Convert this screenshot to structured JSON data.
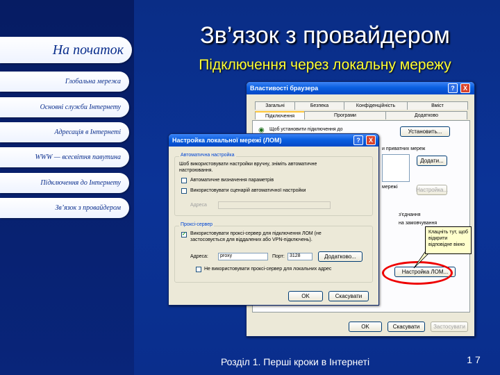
{
  "slide": {
    "title": "Зв’язок з провайдером",
    "subtitle": "Підключення через локальну мережу",
    "footer": "Розділ 1. Перші кроки в Інтернеті",
    "page_number": "1 7"
  },
  "nav": {
    "items": [
      {
        "label": "На початок"
      },
      {
        "label": "Глобальна мережа"
      },
      {
        "label": "Основні служби Інтернету"
      },
      {
        "label": "Адресація в Інтернеті"
      },
      {
        "label": "WWW — всесвітня павутина"
      },
      {
        "label": "Підключення до Інтернету"
      },
      {
        "label": "Зв’язок з провайдером"
      }
    ]
  },
  "browser_props": {
    "title": "Властивості браузера",
    "help": "?",
    "close": "X",
    "tabs": [
      "Загальні",
      "Безпека",
      "Конфіденційність",
      "Вміст",
      "Підключення",
      "Програми",
      "Додатково"
    ],
    "setup_text": "Щоб установити підключення до",
    "setup_button": "Установить...",
    "dialup_text": "и приватних мереж",
    "add_button": "Додати...",
    "settings_button": "Настройка...",
    "text_2": "мережі",
    "text_3": "з'єднання",
    "text_4": "на замовчування",
    "local_settings_button": "Настройка ЛОМ...",
    "ok": "OK",
    "cancel": "Скасувати",
    "apply": "Застосувати"
  },
  "lan_dialog": {
    "title": "Настройка локальної мережі (ЛОМ)",
    "help": "?",
    "close": "X",
    "auto_group_label": "Автоматична настройка",
    "auto_desc": "Шоб використовувати настройки вручну, зніміть автоматичне настроювання.",
    "auto_detect": "Автоматичне визначення параметрів",
    "use_script": "Використовувати сценарій автоматичної настройки",
    "address_label": "Адреса",
    "proxy_group_label": "Проксі-сервер",
    "use_proxy": "Використовувати проксі-сервер для підключення ЛОМ (не застосовується для віддалених або VPN-підключень).",
    "proxy_address_label": "Адреса:",
    "proxy_address_value": "proxy",
    "port_label": "Порт:",
    "port_value": "3128",
    "advanced_button": "Додатково...",
    "bypass_local": "Не використовувати проксі-сервер для локальних адрес",
    "ok": "OK",
    "cancel": "Скасувати"
  },
  "callout": {
    "text": "Клацніть тут, щоб відкрити відповідне вікно"
  },
  "colors": {
    "background": "#0a2e8c",
    "title": "#ffffff",
    "subtitle": "#ffff33",
    "highlight_ring": "#ee0000"
  }
}
